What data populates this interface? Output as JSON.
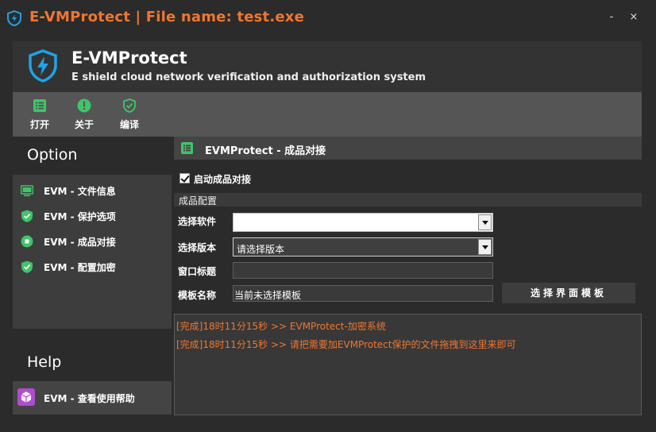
{
  "window": {
    "title": "E-VMProtect | File name: test.exe",
    "minimize_label": "-",
    "close_label": "×"
  },
  "header": {
    "title": "E-VMProtect",
    "subtitle": "E shield cloud network verification and authorization system"
  },
  "toolbar": {
    "items": [
      {
        "label": "打开",
        "icon": "list-icon"
      },
      {
        "label": "关于",
        "icon": "info-icon"
      },
      {
        "label": "编译",
        "icon": "shield-check-icon"
      }
    ]
  },
  "sidebar": {
    "option_heading": "Option",
    "items": [
      {
        "label": "EVM - 文件信息",
        "icon": "monitor-icon"
      },
      {
        "label": "EVM - 保护选项",
        "icon": "shield-check-icon"
      },
      {
        "label": "EVM - 成品对接",
        "icon": "stop-circle-icon"
      },
      {
        "label": "EVM - 配置加密",
        "icon": "shield-check-icon"
      }
    ],
    "help_heading": "Help",
    "help_item": {
      "label": "EVM - 查看使用帮助",
      "icon": "cube-icon"
    }
  },
  "main": {
    "panel_title": "EVMProtect - 成品对接",
    "enable_label": "启动成品对接",
    "enable_checked": true,
    "section_title": "成品配置",
    "software_label": "选择软件",
    "software_value": "",
    "version_label": "选择版本",
    "version_value": "请选择版本",
    "window_title_label": "窗口标题",
    "window_title_value": "",
    "template_label": "模板名称",
    "template_value": "当前未选择模板",
    "template_button": "选择界面模板"
  },
  "log": {
    "lines": [
      "[完成]18时11分15秒 >> EVMProtect-加密系统",
      "[完成]18时11分15秒 >> 请把需要加EVMProtect保护的文件拖拽到这里来即可"
    ]
  },
  "colors": {
    "accent": "#f0762e",
    "icon_green": "#3fc46a",
    "logo_blue": "#1fa3e6",
    "help_icon": "#b04ccb"
  }
}
